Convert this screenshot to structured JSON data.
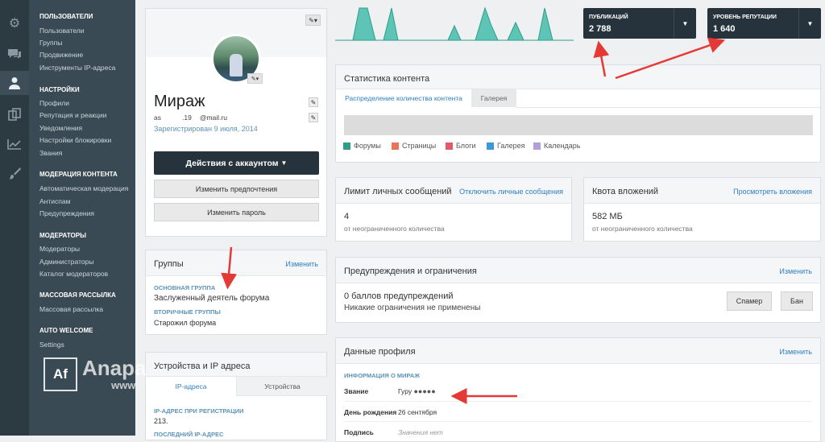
{
  "iconbar": {
    "items": [
      "gears-icon",
      "chat-icon",
      "user-icon",
      "copy-icon",
      "chart-icon",
      "brush-icon"
    ]
  },
  "sidebar": {
    "sections": [
      {
        "title": "Пользователи",
        "items": [
          "Пользователи",
          "Группы",
          "Продвижение",
          "Инструменты IP-адреса"
        ]
      },
      {
        "title": "Настройки",
        "items": [
          "Профили",
          "Репутация и реакции",
          "Уведомления",
          "Настройки блокировки",
          "Звания"
        ]
      },
      {
        "title": "Модерация контента",
        "items": [
          "Автоматическая модерация",
          "Антиспам",
          "Предупреждения"
        ]
      },
      {
        "title": "Модераторы",
        "items": [
          "Модераторы",
          "Администраторы",
          "Каталог модераторов"
        ]
      },
      {
        "title": "Массовая рассылка",
        "items": [
          "Массовая рассылка"
        ]
      },
      {
        "title": "Auto Welcome",
        "items": [
          "Settings"
        ]
      }
    ]
  },
  "watermark": {
    "logo": "Af",
    "name": "Anapa",
    "sub": "www"
  },
  "profile": {
    "name": "Мираж",
    "email_prefix": "as",
    "email_mid": ".19",
    "email_domain": "@mail.ru",
    "registered": "Зарегистрирован 9 июля, 2014",
    "actions_button": "Действия с аккаунтом",
    "prefs_button": "Изменить предпочтения",
    "password_button": "Изменить пароль"
  },
  "groups": {
    "title": "Группы",
    "edit": "Изменить",
    "primary_label": "Основная группа",
    "primary": "Заслуженный деятель форума",
    "secondary_label": "Вторичные группы",
    "secondary": "Старожил форума"
  },
  "devices": {
    "title": "Устройства и IP адреса",
    "tabs": [
      "IP-адреса",
      "Устройства"
    ],
    "reg_ip_label": "IP-адрес при регистрации",
    "reg_ip": "213.",
    "last_ip_label": "Последний IP-адрес"
  },
  "stats": [
    {
      "title": "Публикаций",
      "value": "2 788"
    },
    {
      "title": "Уровень репутации",
      "value": "1 640"
    }
  ],
  "content_stats": {
    "title": "Статистика контента",
    "tabs": [
      "Распределение количества контента",
      "Галерея"
    ],
    "legend": [
      {
        "label": "Форумы",
        "color": "#2e9e8a"
      },
      {
        "label": "Страницы",
        "color": "#e8755a"
      },
      {
        "label": "Блоги",
        "color": "#e05a6a"
      },
      {
        "label": "Галерея",
        "color": "#3a9ad9"
      },
      {
        "label": "Календарь",
        "color": "#b39ddb"
      }
    ]
  },
  "pm_limit": {
    "title": "Лимит личных сообщений",
    "link": "Отключить личные сообщения",
    "value": "4",
    "sub": "от неограниченного количества"
  },
  "quota": {
    "title": "Квота вложений",
    "link": "Просмотреть вложения",
    "value": "582 МБ",
    "sub": "от неограниченного количества"
  },
  "warnings": {
    "title": "Предупреждения и ограничения",
    "edit": "Изменить",
    "points": "0 баллов предупреждений",
    "restrictions": "Никакие ограничения не применены",
    "spammer": "Спамер",
    "ban": "Бан"
  },
  "profile_data": {
    "title": "Данные профиля",
    "edit": "Изменить",
    "info_label": "Информация о Мираж",
    "rank_label": "Звание",
    "rank_value": "Гуру",
    "birthday_label": "День рождения",
    "birthday_value": "26 сентября",
    "signature_label": "Подпись",
    "signature_value": "Значения нет"
  },
  "colors": {
    "sidebar": "#3a4a54",
    "iconbar": "#2c3a42",
    "accent": "#2f7fc1",
    "chart_fill": "#5ec4b6",
    "stat_bg": "#27333c",
    "arrow": "#e53935"
  }
}
